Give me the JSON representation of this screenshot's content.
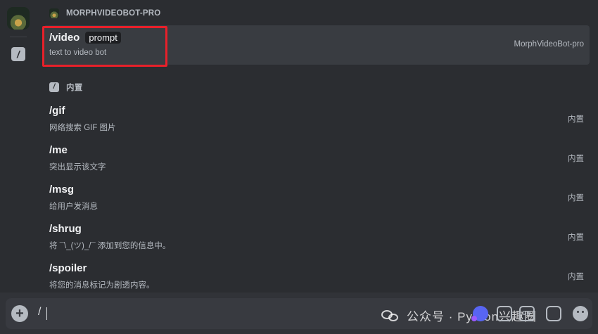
{
  "rail": {
    "server_icon": "server-avatar",
    "builtin_icon": "slash-command-icon"
  },
  "sections": [
    {
      "header": "MORPHVIDEOBOT-PRO",
      "icon": "bot-avatar-icon",
      "commands": [
        {
          "name": "/video",
          "param": "prompt",
          "description": "text to video bot",
          "source": "MorphVideoBot-pro",
          "selected": true
        }
      ]
    },
    {
      "header": "内置",
      "icon": "slash-command-icon",
      "commands": [
        {
          "name": "/gif",
          "description": "网络搜索 GIF 图片",
          "source": "内置"
        },
        {
          "name": "/me",
          "description": "突出显示该文字",
          "source": "内置"
        },
        {
          "name": "/msg",
          "description": "给用户发消息",
          "source": "内置"
        },
        {
          "name": "/shrug",
          "description": "将 ¯\\_(ツ)_/¯ 添加到您的信息中。",
          "source": "内置"
        },
        {
          "name": "/spoiler",
          "description": "将您的消息标记为剧透内容。",
          "source": "内置"
        }
      ]
    }
  ],
  "composer": {
    "value": "/",
    "plus_icon": "add-attachment-icon",
    "watermark": "公众号 · Python兴趣圈",
    "tools": [
      "app-launcher-icon",
      "gift-icon",
      "gif-icon",
      "sticker-icon",
      "emoji-icon"
    ],
    "gif_label": "GIF"
  },
  "colors": {
    "background": "#313338",
    "panel": "#2b2d31",
    "selected_row": "#393c41",
    "highlight_border": "#e8202a",
    "accent": "#5865f2"
  }
}
